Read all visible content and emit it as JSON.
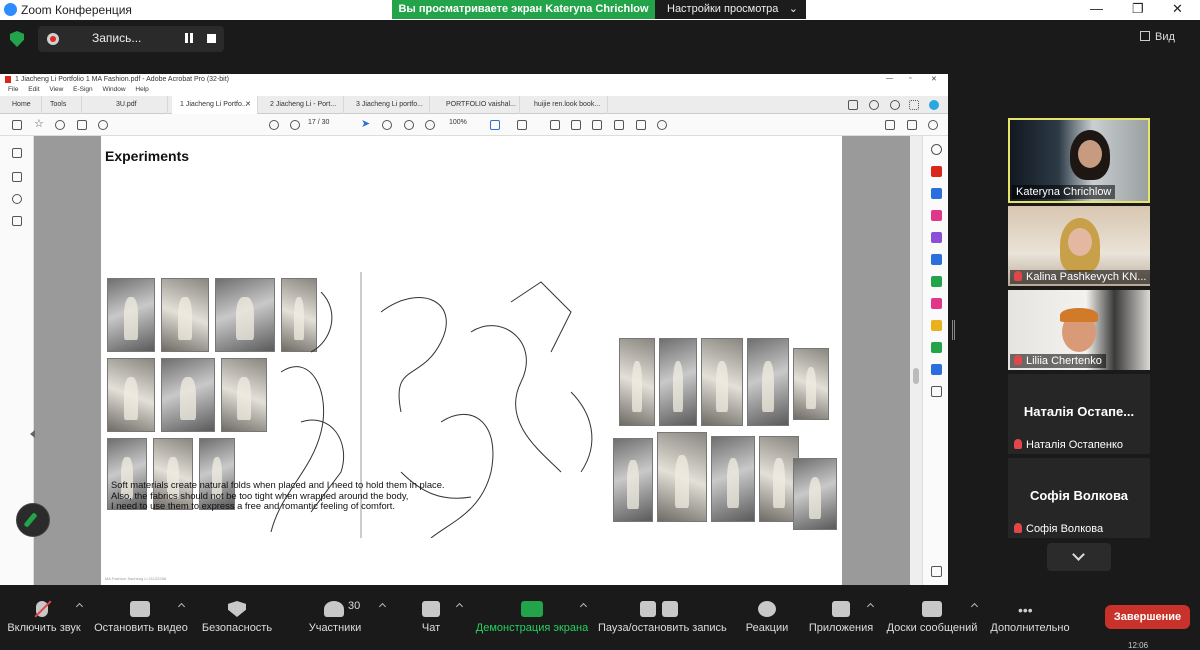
{
  "zoom": {
    "window_title": "Zoom Конференция",
    "share_banner": "Вы просматриваете экран Kateryna Chrichlow",
    "view_settings": "Настройки просмотра",
    "recording_label": "Запись...",
    "view_label": "Вид",
    "win_minimize": "—",
    "win_restore": "❐",
    "win_close": "✕"
  },
  "acrobat": {
    "title": "1 Jiacheng Li Portfolio 1 MA Fashion.pdf - Adobe Acrobat Pro (32-bit)",
    "menu": [
      "File",
      "Edit",
      "View",
      "E-Sign",
      "Window",
      "Help"
    ],
    "tabs": [
      "Home",
      "Tools",
      "3U.pdf",
      "1 Jiacheng Li Portfo...",
      "2 Jiacheng Li - Port...",
      "3 Jiacheng Li portfo...",
      "PORTFOLIO vaishal...",
      "huijie ren.look book..."
    ],
    "active_tab_index": 3,
    "page_current": "17",
    "page_total": "/ 30",
    "zoom_level": "100%",
    "page": {
      "heading": "Experiments",
      "caption": "Soft materials create natural folds when placed and I need to hold them in place.\nAlso, the fabrics should not be too tight when wrapped around the body,\nI need to use them to express a free and romantic feeling of comfort.",
      "footer": "MA Fashion Jiacheng Li 21122286"
    }
  },
  "participants": [
    {
      "name": "Kateryna Chrichlow",
      "muted": false,
      "active_speaker": true
    },
    {
      "name": "Kalina Pashkevych KN...",
      "muted": true
    },
    {
      "name": "Liliia Chertenko",
      "muted": true
    },
    {
      "big_name": "Наталія Остапе...",
      "name": "Наталія Остапенко",
      "muted": true
    },
    {
      "big_name": "Софія Волкова",
      "name": "Софія Волкова",
      "muted": true
    }
  ],
  "toolbar": {
    "unmute": "Включить звук",
    "stop_video": "Остановить видео",
    "security": "Безопасность",
    "participants": "Участники",
    "participants_count": "30",
    "chat": "Чат",
    "share_screen": "Демонстрация экрана",
    "pause_recording": "Пауза/остановить запись",
    "reactions": "Реакции",
    "apps": "Приложения",
    "whiteboards": "Доски сообщений",
    "more": "Дополнительно",
    "end": "Завершение"
  },
  "clock": "12:06",
  "colors": {
    "share_green": "#23a44a",
    "end_red": "#c8322b",
    "active_border": "#e8e46a"
  }
}
